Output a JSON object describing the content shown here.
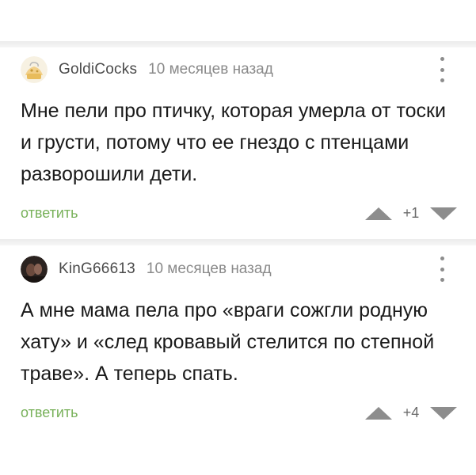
{
  "comments": [
    {
      "username": "GoldiCocks",
      "time": "10 месяцев назад",
      "text": "Мне пели про птичку, которая умерла от тоски и грусти, потому что ее гнездо с птенцами разворошили дети.",
      "reply_label": "ответить",
      "rating": "+1"
    },
    {
      "username": "KinG66613",
      "time": "10 месяцев назад",
      "text": "А мне мама пела про «враги сожгли родную хату» и «след кровавый стелится по степной траве». А теперь спать.",
      "reply_label": "ответить",
      "rating": "+4"
    }
  ],
  "colors": {
    "reply": "#78b15a",
    "icon": "#8d8d8d",
    "divider": "#ececec"
  },
  "icons": [
    "more-vertical-icon",
    "upvote-icon",
    "downvote-icon",
    "avatar"
  ]
}
